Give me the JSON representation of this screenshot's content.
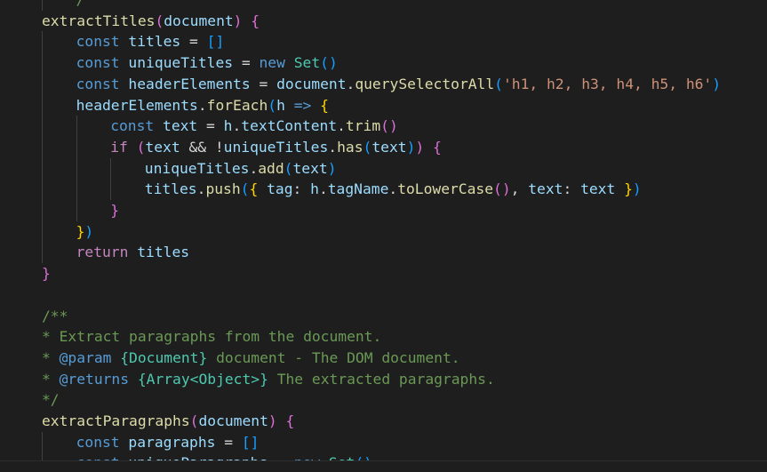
{
  "editor": {
    "theme_colors": {
      "background": "#1e1e1e",
      "default": "#d4d4d4",
      "keyword": "#569cd6",
      "control": "#c586c0",
      "function": "#dcdcaa",
      "variable": "#9cdcfe",
      "string": "#ce9178",
      "comment": "#6a9955",
      "type": "#4ec9b0",
      "bracket1": "#ffd700",
      "bracket2": "#da70d6",
      "bracket3": "#179fff"
    },
    "lines": [
      {
        "indent": 1,
        "tokens": [
          [
            "/",
            "comment"
          ]
        ]
      },
      {
        "indent": 0,
        "tokens": [
          [
            "extractTitles",
            "function"
          ],
          [
            "(",
            "bracket2"
          ],
          [
            "document",
            "variable"
          ],
          [
            ")",
            "bracket2"
          ],
          [
            " ",
            "default"
          ],
          [
            "{",
            "bracket2"
          ]
        ]
      },
      {
        "indent": 1,
        "tokens": [
          [
            "const",
            "keyword"
          ],
          [
            " ",
            "default"
          ],
          [
            "titles",
            "variable"
          ],
          [
            " = ",
            "default"
          ],
          [
            "[]",
            "bracket3"
          ]
        ]
      },
      {
        "indent": 1,
        "tokens": [
          [
            "const",
            "keyword"
          ],
          [
            " ",
            "default"
          ],
          [
            "uniqueTitles",
            "variable"
          ],
          [
            " = ",
            "default"
          ],
          [
            "new",
            "keyword"
          ],
          [
            " ",
            "default"
          ],
          [
            "Set",
            "type"
          ],
          [
            "()",
            "bracket3"
          ]
        ]
      },
      {
        "indent": 1,
        "tokens": [
          [
            "const",
            "keyword"
          ],
          [
            " ",
            "default"
          ],
          [
            "headerElements",
            "variable"
          ],
          [
            " = ",
            "default"
          ],
          [
            "document",
            "variable"
          ],
          [
            ".",
            "default"
          ],
          [
            "querySelectorAll",
            "function"
          ],
          [
            "(",
            "bracket3"
          ],
          [
            "'h1, h2, h3, h4, h5, h6'",
            "string"
          ],
          [
            ")",
            "bracket3"
          ]
        ]
      },
      {
        "indent": 1,
        "tokens": [
          [
            "headerElements",
            "variable"
          ],
          [
            ".",
            "default"
          ],
          [
            "forEach",
            "function"
          ],
          [
            "(",
            "bracket3"
          ],
          [
            "h",
            "variable"
          ],
          [
            " ",
            "default"
          ],
          [
            "=>",
            "keyword"
          ],
          [
            " ",
            "default"
          ],
          [
            "{",
            "bracket1"
          ]
        ]
      },
      {
        "indent": 2,
        "tokens": [
          [
            "const",
            "keyword"
          ],
          [
            " ",
            "default"
          ],
          [
            "text",
            "variable"
          ],
          [
            " = ",
            "default"
          ],
          [
            "h",
            "variable"
          ],
          [
            ".",
            "default"
          ],
          [
            "textContent",
            "variable"
          ],
          [
            ".",
            "default"
          ],
          [
            "trim",
            "function"
          ],
          [
            "()",
            "bracket2"
          ]
        ]
      },
      {
        "indent": 2,
        "tokens": [
          [
            "if",
            "control"
          ],
          [
            " ",
            "default"
          ],
          [
            "(",
            "bracket2"
          ],
          [
            "text",
            "variable"
          ],
          [
            " && !",
            "default"
          ],
          [
            "uniqueTitles",
            "variable"
          ],
          [
            ".",
            "default"
          ],
          [
            "has",
            "function"
          ],
          [
            "(",
            "bracket3"
          ],
          [
            "text",
            "variable"
          ],
          [
            ")",
            "bracket3"
          ],
          [
            ")",
            "bracket2"
          ],
          [
            " ",
            "default"
          ],
          [
            "{",
            "bracket2"
          ]
        ]
      },
      {
        "indent": 3,
        "tokens": [
          [
            "uniqueTitles",
            "variable"
          ],
          [
            ".",
            "default"
          ],
          [
            "add",
            "function"
          ],
          [
            "(",
            "bracket3"
          ],
          [
            "text",
            "variable"
          ],
          [
            ")",
            "bracket3"
          ]
        ]
      },
      {
        "indent": 3,
        "tokens": [
          [
            "titles",
            "variable"
          ],
          [
            ".",
            "default"
          ],
          [
            "push",
            "function"
          ],
          [
            "(",
            "bracket3"
          ],
          [
            "{",
            "bracket1"
          ],
          [
            " ",
            "default"
          ],
          [
            "tag",
            "variable"
          ],
          [
            ": ",
            "default"
          ],
          [
            "h",
            "variable"
          ],
          [
            ".",
            "default"
          ],
          [
            "tagName",
            "variable"
          ],
          [
            ".",
            "default"
          ],
          [
            "toLowerCase",
            "function"
          ],
          [
            "()",
            "bracket2"
          ],
          [
            ", ",
            "default"
          ],
          [
            "text",
            "variable"
          ],
          [
            ": ",
            "default"
          ],
          [
            "text",
            "variable"
          ],
          [
            " ",
            "default"
          ],
          [
            "}",
            "bracket1"
          ],
          [
            ")",
            "bracket3"
          ]
        ]
      },
      {
        "indent": 2,
        "tokens": [
          [
            "}",
            "bracket2"
          ]
        ]
      },
      {
        "indent": 1,
        "tokens": [
          [
            "}",
            "bracket1"
          ],
          [
            ")",
            "bracket3"
          ]
        ]
      },
      {
        "indent": 1,
        "tokens": [
          [
            "return",
            "control"
          ],
          [
            " ",
            "default"
          ],
          [
            "titles",
            "variable"
          ]
        ]
      },
      {
        "indent": 0,
        "tokens": [
          [
            "}",
            "bracket2"
          ]
        ]
      },
      {
        "indent": 0,
        "tokens": []
      },
      {
        "indent": 0,
        "tokens": [
          [
            "/**",
            "comment"
          ]
        ]
      },
      {
        "indent": 0,
        "tokens": [
          [
            "* Extract paragraphs from the document.",
            "comment"
          ]
        ]
      },
      {
        "indent": 0,
        "tokens": [
          [
            "* ",
            "comment"
          ],
          [
            "@param",
            "keyword"
          ],
          [
            " ",
            "comment"
          ],
          [
            "{Document}",
            "type"
          ],
          [
            " document - The DOM document.",
            "comment"
          ]
        ]
      },
      {
        "indent": 0,
        "tokens": [
          [
            "* ",
            "comment"
          ],
          [
            "@returns",
            "keyword"
          ],
          [
            " ",
            "comment"
          ],
          [
            "{Array<Object>}",
            "type"
          ],
          [
            " The extracted paragraphs.",
            "comment"
          ]
        ]
      },
      {
        "indent": 0,
        "tokens": [
          [
            "*/",
            "comment"
          ]
        ]
      },
      {
        "indent": 0,
        "tokens": [
          [
            "extractParagraphs",
            "function"
          ],
          [
            "(",
            "bracket2"
          ],
          [
            "document",
            "variable"
          ],
          [
            ")",
            "bracket2"
          ],
          [
            " ",
            "default"
          ],
          [
            "{",
            "bracket2"
          ]
        ]
      },
      {
        "indent": 1,
        "tokens": [
          [
            "const",
            "keyword"
          ],
          [
            " ",
            "default"
          ],
          [
            "paragraphs",
            "variable"
          ],
          [
            " = ",
            "default"
          ],
          [
            "[]",
            "bracket3"
          ]
        ]
      },
      {
        "indent": 1,
        "tokens": [
          [
            "const",
            "keyword"
          ],
          [
            " ",
            "default"
          ],
          [
            "uniqueParagraphs",
            "variable"
          ],
          [
            " = ",
            "default"
          ],
          [
            "new",
            "keyword"
          ],
          [
            " ",
            "default"
          ],
          [
            "Set",
            "type"
          ],
          [
            "()",
            "bracket3"
          ]
        ]
      }
    ]
  }
}
